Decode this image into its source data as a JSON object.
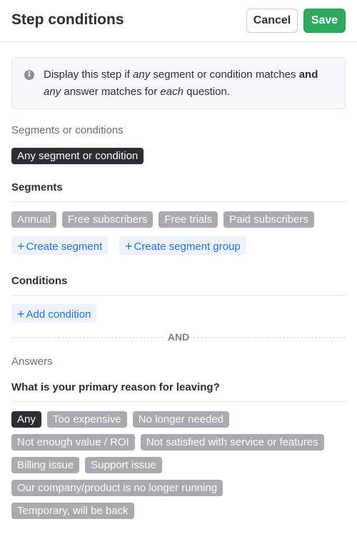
{
  "header": {
    "title": "Step conditions",
    "cancel_label": "Cancel",
    "save_label": "Save"
  },
  "info": {
    "icon": "info-icon",
    "text_1": "Display this step if ",
    "text_any_1": "any",
    "text_2": " segment or condition matches ",
    "text_and": "and",
    "text_any_2": "any",
    "text_3": " answer matches for ",
    "text_each": "each",
    "text_4": " question."
  },
  "segments_or_conditions": {
    "label": "Segments or conditions",
    "selected": "Any segment or condition"
  },
  "segments": {
    "heading": "Segments",
    "items": [
      "Annual",
      "Free subscribers",
      "Free trials",
      "Paid subscribers"
    ],
    "create_segment_label": "Create segment",
    "create_segment_group_label": "Create segment group"
  },
  "conditions": {
    "heading": "Conditions",
    "add_condition_label": "Add condition"
  },
  "divider": {
    "label": "AND"
  },
  "answers": {
    "label": "Answers",
    "question": "What is your primary reason for leaving?",
    "selected": "Any",
    "options": [
      "Too expensive",
      "No longer needed",
      "Not enough value / ROI",
      "Not satisfied with service or features",
      "Billing issue",
      "Support issue",
      "Our company/product is no longer running",
      "Temporary, will be back"
    ]
  },
  "colors": {
    "save": "#2fa860",
    "pill": "#a7aaae",
    "pill_selected": "#2a2d31",
    "link": "#2d6fd6"
  }
}
